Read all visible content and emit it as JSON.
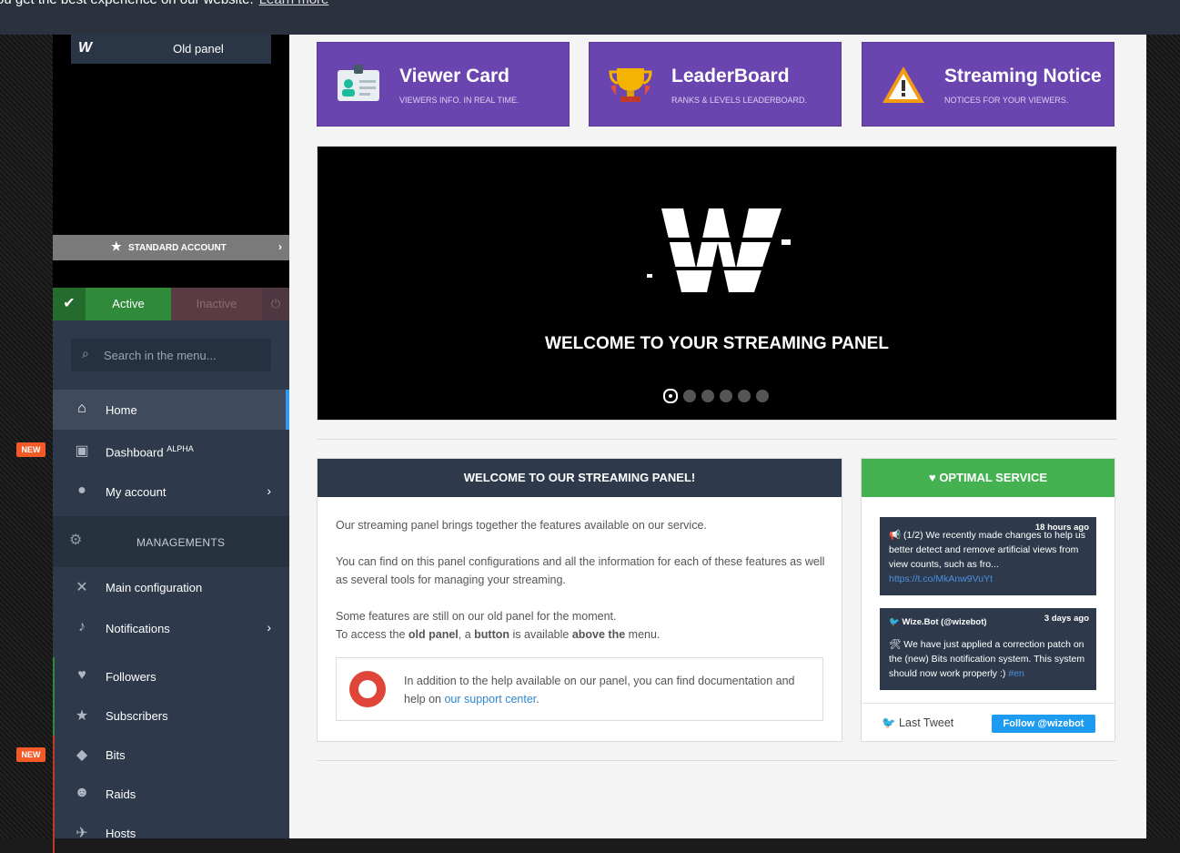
{
  "cookie_banner": {
    "text": "ou get the best experience on our website.",
    "link": "Learn more"
  },
  "sidebar": {
    "old_panel": "Old panel",
    "account_type": "STANDARD ACCOUNT",
    "status_active": "Active",
    "status_inactive": "Inactive",
    "search_placeholder": "Search in the menu...",
    "items": [
      {
        "label": "Home",
        "icon": "home-icon"
      },
      {
        "label": "Dashboard",
        "sup": "ALPHA",
        "badge": "NEW",
        "icon": "dashboard-icon"
      },
      {
        "label": "My account",
        "icon": "user-icon"
      },
      {
        "label": "Main configuration",
        "icon": "tools-icon"
      },
      {
        "label": "Notifications",
        "icon": "bell-icon"
      },
      {
        "label": "Followers",
        "icon": "heart-icon"
      },
      {
        "label": "Subscribers",
        "icon": "star-icon"
      },
      {
        "label": "Bits",
        "badge": "NEW",
        "icon": "diamond-icon"
      },
      {
        "label": "Raids",
        "icon": "users-icon"
      },
      {
        "label": "Hosts",
        "icon": "host-icon"
      }
    ],
    "section_label": "MANAGEMENTS"
  },
  "tiles": [
    {
      "title": "Viewer Card",
      "subtitle": "VIEWERS INFO. IN REAL TIME.",
      "icon": "id-card-icon"
    },
    {
      "title": "LeaderBoard",
      "subtitle": "RANKS & LEVELS LEADERBOARD.",
      "icon": "trophy-icon"
    },
    {
      "title": "Streaming Notice",
      "subtitle": "NOTICES FOR YOUR VIEWERS.",
      "icon": "warning-icon"
    }
  ],
  "banner": {
    "text": "WELCOME TO YOUR STREAMING PANEL",
    "slide_count": 6,
    "active_slide": 1
  },
  "welcome_panel": {
    "title": "WELCOME TO OUR STREAMING PANEL!",
    "p1": "Our streaming panel brings together the features available on our service.",
    "p2": "You can find on this panel configurations and all the information for each of these features as well as several tools for managing your streaming.",
    "p3a": "Some features are still on our old panel for the moment.",
    "p3b_1": "To access the ",
    "p3b_old": "old panel",
    "p3b_2": ", a ",
    "p3b_button": "button",
    "p3b_3": " is available ",
    "p3b_above": "above the",
    "p3b_4": " menu.",
    "help_text": "In addition to the help available on our panel, you can find documentation and help on ",
    "help_link": "our support center",
    "help_end": "."
  },
  "service": {
    "title": "OPTIMAL SERVICE",
    "tweets": [
      {
        "time": "18 hours ago",
        "text": "(1/2) We recently made changes to help us better detect and remove artificial views from view counts, such as fro...",
        "link": "https://t.co/MkAnw9VuYt"
      },
      {
        "author": "Wize.Bot (@wizebot)",
        "time": "3 days ago",
        "text": "We have just applied a correction patch on the (new) Bits notification system. This system should now work properly :)",
        "tag": "#en"
      }
    ],
    "last_tweet": "Last Tweet",
    "follow": "Follow @wizebot"
  },
  "colors": {
    "accent": "#6a45b0",
    "sidebar": "#2e3a4b",
    "active": "#2f8a3a",
    "service": "#45b252",
    "badge": "#f45a27"
  }
}
